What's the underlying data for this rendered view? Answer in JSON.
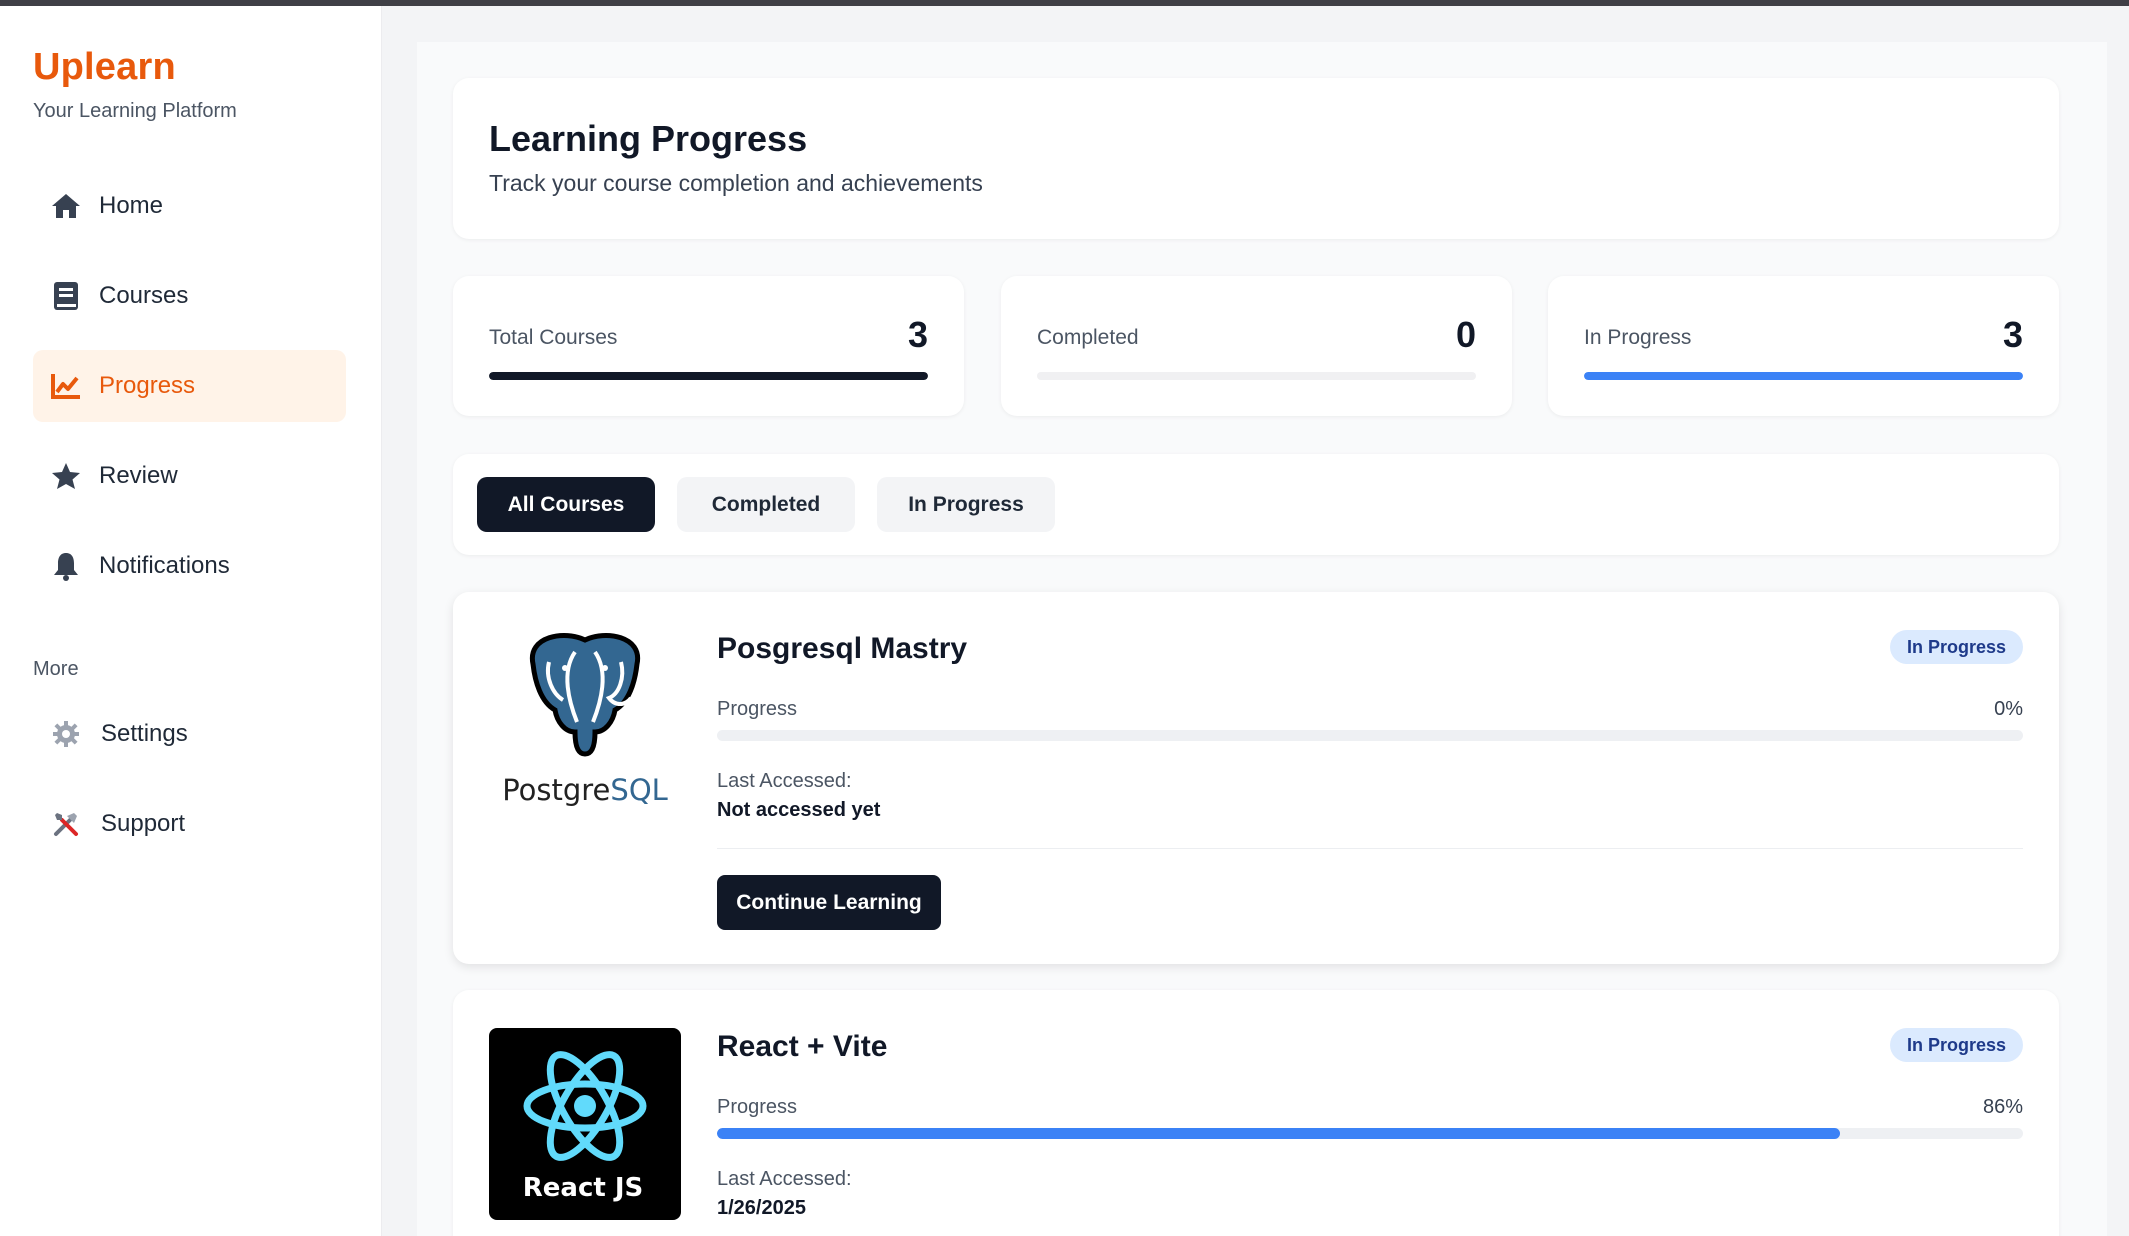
{
  "brand": {
    "name": "Uplearn",
    "tagline": "Your Learning Platform",
    "accent_color": "#e8590c"
  },
  "sidebar": {
    "items": [
      {
        "label": "Home",
        "icon": "home-icon"
      },
      {
        "label": "Courses",
        "icon": "book-icon"
      },
      {
        "label": "Progress",
        "icon": "chart-line-icon",
        "active": true
      },
      {
        "label": "Review",
        "icon": "star-icon"
      },
      {
        "label": "Notifications",
        "icon": "bell-icon"
      }
    ],
    "more_label": "More",
    "more_items": [
      {
        "label": "Settings",
        "icon": "gear-icon"
      },
      {
        "label": "Support",
        "icon": "tools-icon"
      }
    ]
  },
  "header": {
    "title": "Learning Progress",
    "subtitle": "Track your course completion and achievements"
  },
  "stats": [
    {
      "label": "Total Courses",
      "value": "3",
      "bar_fraction": 1.0,
      "bar_color": "#111827"
    },
    {
      "label": "Completed",
      "value": "0",
      "bar_fraction": 0.0,
      "bar_color": "#22c55e"
    },
    {
      "label": "In Progress",
      "value": "3",
      "bar_fraction": 1.0,
      "bar_color": "#3b82f6"
    }
  ],
  "filters": {
    "options": [
      "All Courses",
      "Completed",
      "In Progress"
    ],
    "selected": "All Courses"
  },
  "courses": [
    {
      "title": "Posgresql Mastry",
      "logo": "postgresql-logo",
      "logo_text": "PostgreSQL",
      "status": "In Progress",
      "progress_label": "Progress",
      "progress_text": "0%",
      "progress_fraction": 0.0,
      "last_accessed_label": "Last Accessed:",
      "last_accessed": "Not accessed yet",
      "button_label": "Continue Learning"
    },
    {
      "title": "React + Vite",
      "logo": "react-logo",
      "logo_text": "React JS",
      "status": "In Progress",
      "progress_label": "Progress",
      "progress_text": "86%",
      "progress_fraction": 0.86,
      "last_accessed_label": "Last Accessed:",
      "last_accessed": "1/26/2025"
    }
  ],
  "colors": {
    "dark": "#111827",
    "progress_blue": "#3b82f6",
    "badge_bg": "#dbeafe"
  }
}
